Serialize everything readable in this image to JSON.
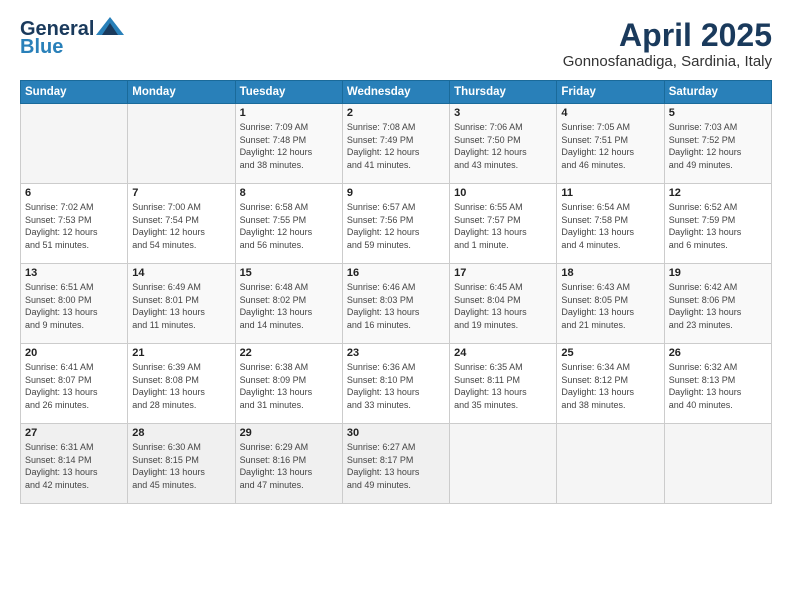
{
  "header": {
    "logo_line1": "General",
    "logo_line2": "Blue",
    "month": "April 2025",
    "location": "Gonnosfanadiga, Sardinia, Italy"
  },
  "days_of_week": [
    "Sunday",
    "Monday",
    "Tuesday",
    "Wednesday",
    "Thursday",
    "Friday",
    "Saturday"
  ],
  "weeks": [
    [
      {
        "day": "",
        "info": ""
      },
      {
        "day": "",
        "info": ""
      },
      {
        "day": "1",
        "info": "Sunrise: 7:09 AM\nSunset: 7:48 PM\nDaylight: 12 hours\nand 38 minutes."
      },
      {
        "day": "2",
        "info": "Sunrise: 7:08 AM\nSunset: 7:49 PM\nDaylight: 12 hours\nand 41 minutes."
      },
      {
        "day": "3",
        "info": "Sunrise: 7:06 AM\nSunset: 7:50 PM\nDaylight: 12 hours\nand 43 minutes."
      },
      {
        "day": "4",
        "info": "Sunrise: 7:05 AM\nSunset: 7:51 PM\nDaylight: 12 hours\nand 46 minutes."
      },
      {
        "day": "5",
        "info": "Sunrise: 7:03 AM\nSunset: 7:52 PM\nDaylight: 12 hours\nand 49 minutes."
      }
    ],
    [
      {
        "day": "6",
        "info": "Sunrise: 7:02 AM\nSunset: 7:53 PM\nDaylight: 12 hours\nand 51 minutes."
      },
      {
        "day": "7",
        "info": "Sunrise: 7:00 AM\nSunset: 7:54 PM\nDaylight: 12 hours\nand 54 minutes."
      },
      {
        "day": "8",
        "info": "Sunrise: 6:58 AM\nSunset: 7:55 PM\nDaylight: 12 hours\nand 56 minutes."
      },
      {
        "day": "9",
        "info": "Sunrise: 6:57 AM\nSunset: 7:56 PM\nDaylight: 12 hours\nand 59 minutes."
      },
      {
        "day": "10",
        "info": "Sunrise: 6:55 AM\nSunset: 7:57 PM\nDaylight: 13 hours\nand 1 minute."
      },
      {
        "day": "11",
        "info": "Sunrise: 6:54 AM\nSunset: 7:58 PM\nDaylight: 13 hours\nand 4 minutes."
      },
      {
        "day": "12",
        "info": "Sunrise: 6:52 AM\nSunset: 7:59 PM\nDaylight: 13 hours\nand 6 minutes."
      }
    ],
    [
      {
        "day": "13",
        "info": "Sunrise: 6:51 AM\nSunset: 8:00 PM\nDaylight: 13 hours\nand 9 minutes."
      },
      {
        "day": "14",
        "info": "Sunrise: 6:49 AM\nSunset: 8:01 PM\nDaylight: 13 hours\nand 11 minutes."
      },
      {
        "day": "15",
        "info": "Sunrise: 6:48 AM\nSunset: 8:02 PM\nDaylight: 13 hours\nand 14 minutes."
      },
      {
        "day": "16",
        "info": "Sunrise: 6:46 AM\nSunset: 8:03 PM\nDaylight: 13 hours\nand 16 minutes."
      },
      {
        "day": "17",
        "info": "Sunrise: 6:45 AM\nSunset: 8:04 PM\nDaylight: 13 hours\nand 19 minutes."
      },
      {
        "day": "18",
        "info": "Sunrise: 6:43 AM\nSunset: 8:05 PM\nDaylight: 13 hours\nand 21 minutes."
      },
      {
        "day": "19",
        "info": "Sunrise: 6:42 AM\nSunset: 8:06 PM\nDaylight: 13 hours\nand 23 minutes."
      }
    ],
    [
      {
        "day": "20",
        "info": "Sunrise: 6:41 AM\nSunset: 8:07 PM\nDaylight: 13 hours\nand 26 minutes."
      },
      {
        "day": "21",
        "info": "Sunrise: 6:39 AM\nSunset: 8:08 PM\nDaylight: 13 hours\nand 28 minutes."
      },
      {
        "day": "22",
        "info": "Sunrise: 6:38 AM\nSunset: 8:09 PM\nDaylight: 13 hours\nand 31 minutes."
      },
      {
        "day": "23",
        "info": "Sunrise: 6:36 AM\nSunset: 8:10 PM\nDaylight: 13 hours\nand 33 minutes."
      },
      {
        "day": "24",
        "info": "Sunrise: 6:35 AM\nSunset: 8:11 PM\nDaylight: 13 hours\nand 35 minutes."
      },
      {
        "day": "25",
        "info": "Sunrise: 6:34 AM\nSunset: 8:12 PM\nDaylight: 13 hours\nand 38 minutes."
      },
      {
        "day": "26",
        "info": "Sunrise: 6:32 AM\nSunset: 8:13 PM\nDaylight: 13 hours\nand 40 minutes."
      }
    ],
    [
      {
        "day": "27",
        "info": "Sunrise: 6:31 AM\nSunset: 8:14 PM\nDaylight: 13 hours\nand 42 minutes."
      },
      {
        "day": "28",
        "info": "Sunrise: 6:30 AM\nSunset: 8:15 PM\nDaylight: 13 hours\nand 45 minutes."
      },
      {
        "day": "29",
        "info": "Sunrise: 6:29 AM\nSunset: 8:16 PM\nDaylight: 13 hours\nand 47 minutes."
      },
      {
        "day": "30",
        "info": "Sunrise: 6:27 AM\nSunset: 8:17 PM\nDaylight: 13 hours\nand 49 minutes."
      },
      {
        "day": "",
        "info": ""
      },
      {
        "day": "",
        "info": ""
      },
      {
        "day": "",
        "info": ""
      }
    ]
  ]
}
